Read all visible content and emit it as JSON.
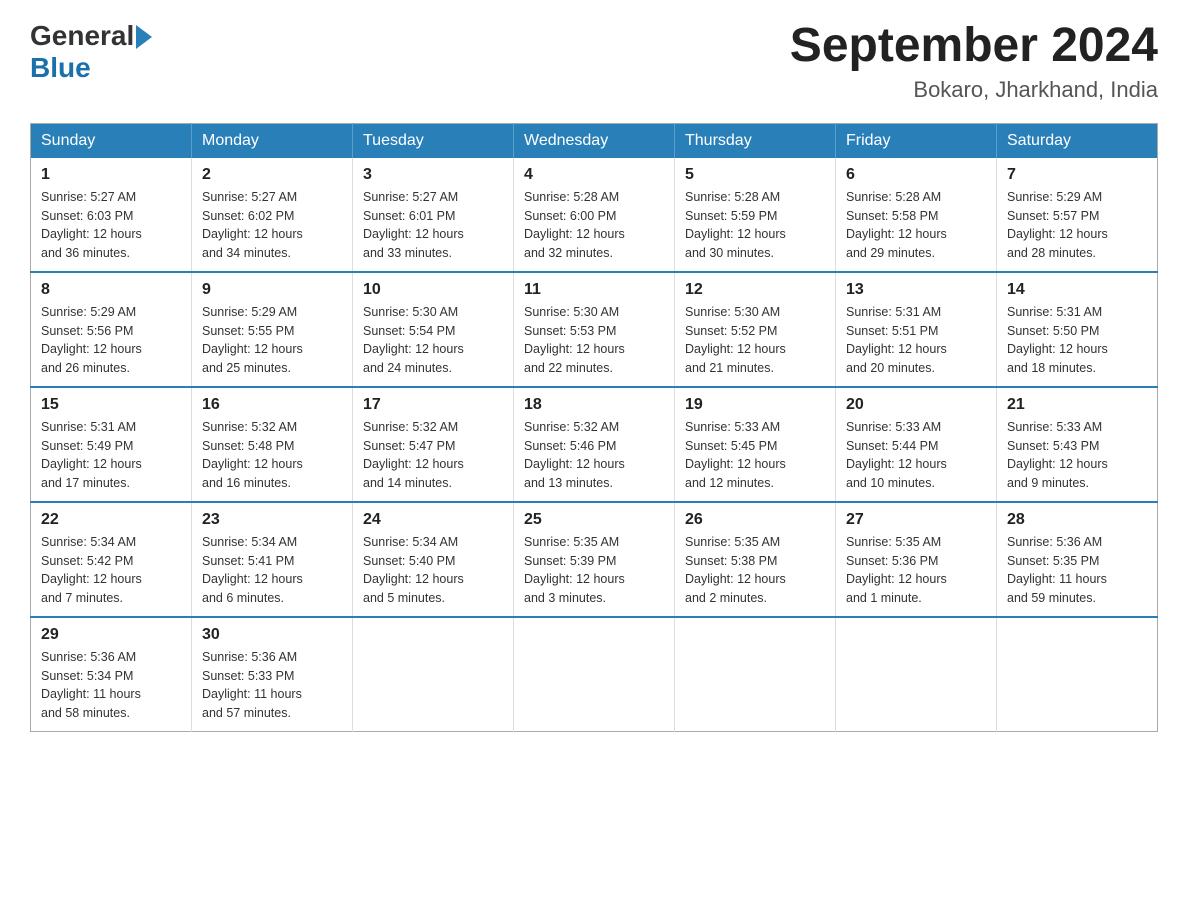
{
  "header": {
    "logo_general": "General",
    "logo_blue": "Blue",
    "calendar_title": "September 2024",
    "calendar_subtitle": "Bokaro, Jharkhand, India"
  },
  "weekdays": [
    "Sunday",
    "Monday",
    "Tuesday",
    "Wednesday",
    "Thursday",
    "Friday",
    "Saturday"
  ],
  "weeks": [
    [
      {
        "day": "1",
        "sunrise": "5:27 AM",
        "sunset": "6:03 PM",
        "daylight": "12 hours and 36 minutes."
      },
      {
        "day": "2",
        "sunrise": "5:27 AM",
        "sunset": "6:02 PM",
        "daylight": "12 hours and 34 minutes."
      },
      {
        "day": "3",
        "sunrise": "5:27 AM",
        "sunset": "6:01 PM",
        "daylight": "12 hours and 33 minutes."
      },
      {
        "day": "4",
        "sunrise": "5:28 AM",
        "sunset": "6:00 PM",
        "daylight": "12 hours and 32 minutes."
      },
      {
        "day": "5",
        "sunrise": "5:28 AM",
        "sunset": "5:59 PM",
        "daylight": "12 hours and 30 minutes."
      },
      {
        "day": "6",
        "sunrise": "5:28 AM",
        "sunset": "5:58 PM",
        "daylight": "12 hours and 29 minutes."
      },
      {
        "day": "7",
        "sunrise": "5:29 AM",
        "sunset": "5:57 PM",
        "daylight": "12 hours and 28 minutes."
      }
    ],
    [
      {
        "day": "8",
        "sunrise": "5:29 AM",
        "sunset": "5:56 PM",
        "daylight": "12 hours and 26 minutes."
      },
      {
        "day": "9",
        "sunrise": "5:29 AM",
        "sunset": "5:55 PM",
        "daylight": "12 hours and 25 minutes."
      },
      {
        "day": "10",
        "sunrise": "5:30 AM",
        "sunset": "5:54 PM",
        "daylight": "12 hours and 24 minutes."
      },
      {
        "day": "11",
        "sunrise": "5:30 AM",
        "sunset": "5:53 PM",
        "daylight": "12 hours and 22 minutes."
      },
      {
        "day": "12",
        "sunrise": "5:30 AM",
        "sunset": "5:52 PM",
        "daylight": "12 hours and 21 minutes."
      },
      {
        "day": "13",
        "sunrise": "5:31 AM",
        "sunset": "5:51 PM",
        "daylight": "12 hours and 20 minutes."
      },
      {
        "day": "14",
        "sunrise": "5:31 AM",
        "sunset": "5:50 PM",
        "daylight": "12 hours and 18 minutes."
      }
    ],
    [
      {
        "day": "15",
        "sunrise": "5:31 AM",
        "sunset": "5:49 PM",
        "daylight": "12 hours and 17 minutes."
      },
      {
        "day": "16",
        "sunrise": "5:32 AM",
        "sunset": "5:48 PM",
        "daylight": "12 hours and 16 minutes."
      },
      {
        "day": "17",
        "sunrise": "5:32 AM",
        "sunset": "5:47 PM",
        "daylight": "12 hours and 14 minutes."
      },
      {
        "day": "18",
        "sunrise": "5:32 AM",
        "sunset": "5:46 PM",
        "daylight": "12 hours and 13 minutes."
      },
      {
        "day": "19",
        "sunrise": "5:33 AM",
        "sunset": "5:45 PM",
        "daylight": "12 hours and 12 minutes."
      },
      {
        "day": "20",
        "sunrise": "5:33 AM",
        "sunset": "5:44 PM",
        "daylight": "12 hours and 10 minutes."
      },
      {
        "day": "21",
        "sunrise": "5:33 AM",
        "sunset": "5:43 PM",
        "daylight": "12 hours and 9 minutes."
      }
    ],
    [
      {
        "day": "22",
        "sunrise": "5:34 AM",
        "sunset": "5:42 PM",
        "daylight": "12 hours and 7 minutes."
      },
      {
        "day": "23",
        "sunrise": "5:34 AM",
        "sunset": "5:41 PM",
        "daylight": "12 hours and 6 minutes."
      },
      {
        "day": "24",
        "sunrise": "5:34 AM",
        "sunset": "5:40 PM",
        "daylight": "12 hours and 5 minutes."
      },
      {
        "day": "25",
        "sunrise": "5:35 AM",
        "sunset": "5:39 PM",
        "daylight": "12 hours and 3 minutes."
      },
      {
        "day": "26",
        "sunrise": "5:35 AM",
        "sunset": "5:38 PM",
        "daylight": "12 hours and 2 minutes."
      },
      {
        "day": "27",
        "sunrise": "5:35 AM",
        "sunset": "5:36 PM",
        "daylight": "12 hours and 1 minute."
      },
      {
        "day": "28",
        "sunrise": "5:36 AM",
        "sunset": "5:35 PM",
        "daylight": "11 hours and 59 minutes."
      }
    ],
    [
      {
        "day": "29",
        "sunrise": "5:36 AM",
        "sunset": "5:34 PM",
        "daylight": "11 hours and 58 minutes."
      },
      {
        "day": "30",
        "sunrise": "5:36 AM",
        "sunset": "5:33 PM",
        "daylight": "11 hours and 57 minutes."
      },
      null,
      null,
      null,
      null,
      null
    ]
  ],
  "labels": {
    "sunrise": "Sunrise:",
    "sunset": "Sunset:",
    "daylight": "Daylight:"
  }
}
